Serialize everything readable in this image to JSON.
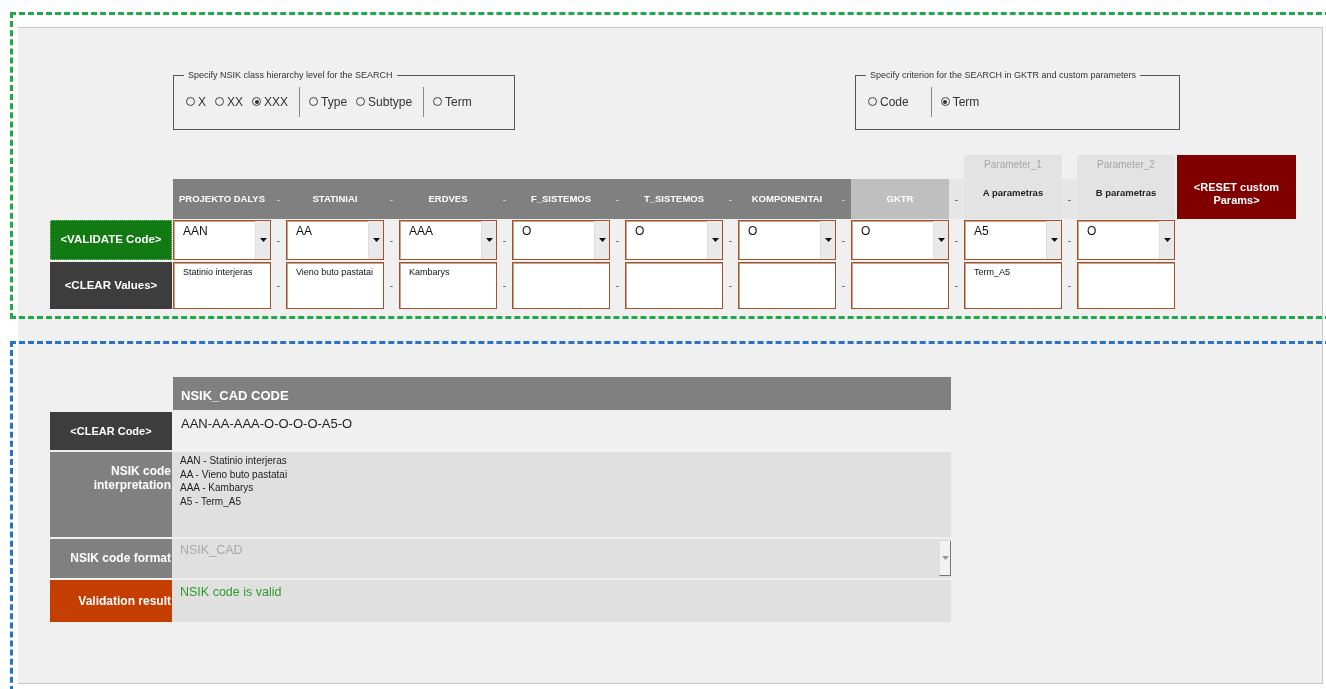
{
  "search_level": {
    "legend": "Specify NSIK class hierarchy level for the SEARCH",
    "groups": [
      {
        "options": [
          {
            "label": "X",
            "selected": false
          },
          {
            "label": "XX",
            "selected": false
          },
          {
            "label": "XXX",
            "selected": true
          }
        ]
      },
      {
        "options": [
          {
            "label": "Type",
            "selected": false
          },
          {
            "label": "Subtype",
            "selected": false
          }
        ]
      },
      {
        "options": [
          {
            "label": "Term",
            "selected": false
          }
        ]
      }
    ]
  },
  "search_criterion": {
    "legend": "Specify criterion for the SEARCH in GKTR and custom parameters",
    "groups": [
      {
        "options": [
          {
            "label": "Code",
            "selected": false
          }
        ]
      },
      {
        "options": [
          {
            "label": "Term",
            "selected": true
          }
        ]
      }
    ]
  },
  "row_buttons": {
    "validate": "<VALIDATE Code>",
    "clear_values": "<CLEAR Values>"
  },
  "reset_button": "<RESET custom Params>",
  "columns": [
    {
      "kind": "section",
      "header": "PROJEKTO DALYS",
      "code": "AAN",
      "term": "Statinio interjeras"
    },
    {
      "kind": "section",
      "separator": {
        "header": "-",
        "code": "-",
        "term": "-"
      },
      "header": "STATINIAI",
      "code": "AA",
      "term": "Vieno buto pastatai"
    },
    {
      "kind": "section",
      "separator": {
        "header": "-",
        "code": "-",
        "term": "-"
      },
      "header": "ERDVES",
      "code": "AAA",
      "term": "Kambarys"
    },
    {
      "kind": "section",
      "separator": {
        "header": "-",
        "code": "-",
        "term": "-"
      },
      "header": "F_SISTEMOS",
      "code": "O"
    },
    {
      "kind": "section",
      "separator": {
        "header": "-",
        "code": "-",
        "term": "-"
      },
      "header": "T_SISTEMOS",
      "code": "O"
    },
    {
      "kind": "section",
      "separator": {
        "header": "-",
        "code": "-",
        "term": "-"
      },
      "header": "KOMPONENTAI",
      "code": "O"
    },
    {
      "kind": "gktr",
      "separator": {
        "header": "-",
        "code": "-",
        "term": "-"
      },
      "header": "GKTR",
      "code": "O"
    },
    {
      "kind": "parameter",
      "separator": {
        "header": "-",
        "code": "-",
        "term": "-"
      },
      "parameter": "Parameter_1",
      "header": "A parametras",
      "code": "A5",
      "term": "Term_A5"
    },
    {
      "kind": "parameter",
      "separator": {
        "header": "-",
        "code": "-",
        "term": "-"
      },
      "parameter": "Parameter_2",
      "header": "B parametras",
      "code": "O"
    }
  ],
  "output": {
    "header": "NSIK_CAD CODE",
    "clear_button": "<CLEAR Code>",
    "code": "AAN-AA-AAA-O-O-O-O-A5-O",
    "interpretation": {
      "label": "NSIK code interpretation",
      "lines": [
        "AAN - Statinio interjeras",
        "AA - Vieno buto pastatai",
        "AAA - Kambarys",
        "A5 - Term_A5"
      ]
    },
    "format": {
      "label": "NSIK code format",
      "value": "NSIK_CAD",
      "disabled": true
    },
    "validation": {
      "label": "Validation result",
      "message": "NSIK code is valid",
      "valid": true
    }
  }
}
